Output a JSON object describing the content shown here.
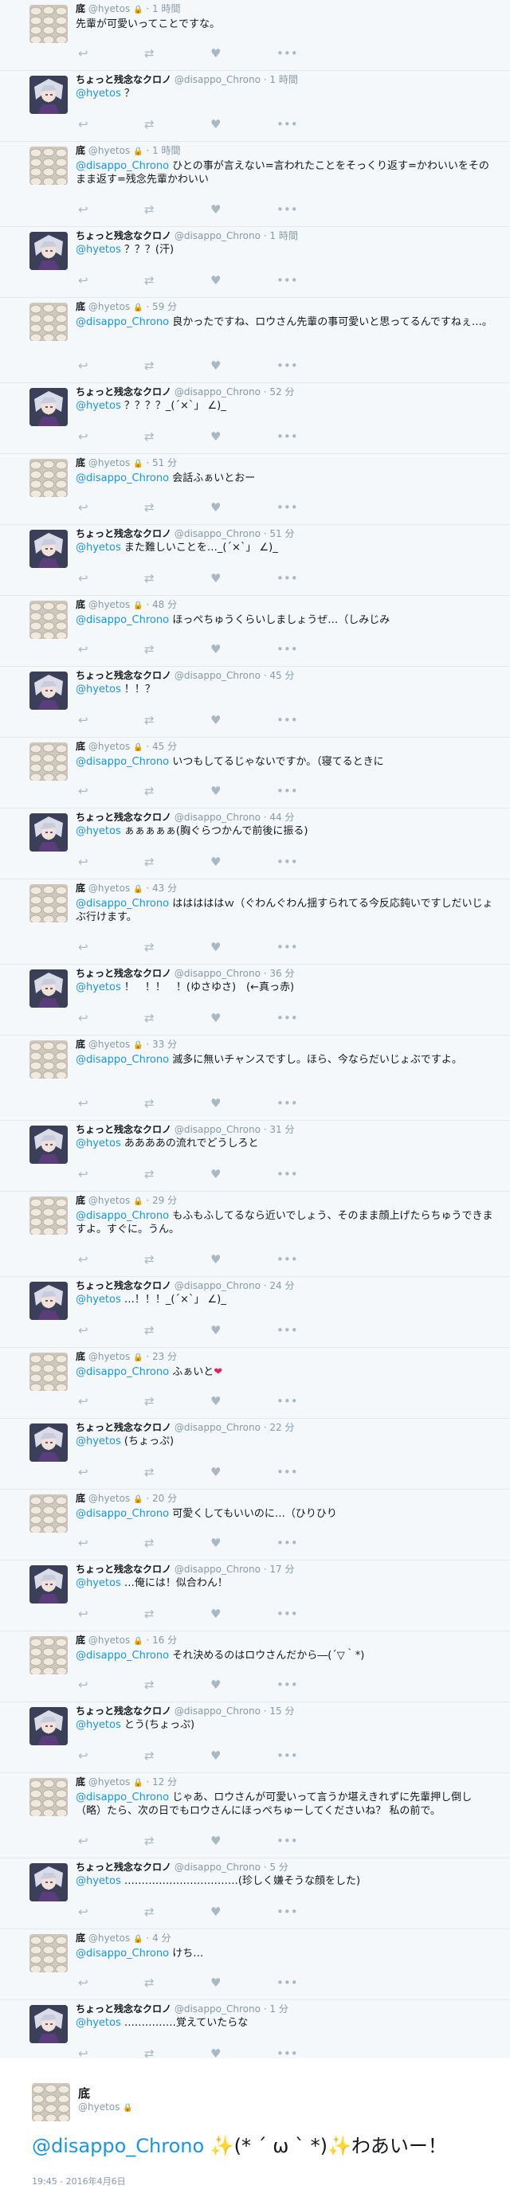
{
  "tweets": [
    {
      "author": "tofu",
      "name": "底",
      "handle": "@hyetos",
      "locked": true,
      "time": "1 時間",
      "mention": "",
      "text": "先輩が可愛いってことですな。",
      "tall": false
    },
    {
      "author": "chrono",
      "name": "ちょっと残念なクロノ",
      "handle": "@disappo_Chrono",
      "locked": false,
      "time": "1 時間",
      "mention": "@hyetos",
      "text": " ？",
      "tall": false
    },
    {
      "author": "tofu",
      "name": "底",
      "handle": "@hyetos",
      "locked": true,
      "time": "1 時間",
      "mention": "@disappo_Chrono",
      "text": " ひとの事が言えない=言われたことをそっくり返す=かわいいをそのまま返す=残念先輩かわいい",
      "tall": true
    },
    {
      "author": "chrono",
      "name": "ちょっと残念なクロノ",
      "handle": "@disappo_Chrono",
      "locked": false,
      "time": "1 時間",
      "mention": "@hyetos",
      "text": " ？？？(汗)",
      "tall": false
    },
    {
      "author": "tofu",
      "name": "底",
      "handle": "@hyetos",
      "locked": true,
      "time": "59 分",
      "mention": "@disappo_Chrono",
      "text": " 良かったですね、ロウさん先輩の事可愛いと思ってるんですねぇ…。",
      "tall": true
    },
    {
      "author": "chrono",
      "name": "ちょっと残念なクロノ",
      "handle": "@disappo_Chrono",
      "locked": false,
      "time": "52 分",
      "mention": "@hyetos",
      "text": " ？？？？_(´×`」 ∠)_",
      "tall": false
    },
    {
      "author": "tofu",
      "name": "底",
      "handle": "@hyetos",
      "locked": true,
      "time": "51 分",
      "mention": "@disappo_Chrono",
      "text": " 会話ふぁいとおー",
      "tall": false
    },
    {
      "author": "chrono",
      "name": "ちょっと残念なクロノ",
      "handle": "@disappo_Chrono",
      "locked": false,
      "time": "51 分",
      "mention": "@hyetos",
      "text": " また難しいことを…_(´×`」 ∠)_",
      "tall": false
    },
    {
      "author": "tofu",
      "name": "底",
      "handle": "@hyetos",
      "locked": true,
      "time": "48 分",
      "mention": "@disappo_Chrono",
      "text": " ほっぺちゅうくらいしましょうぜ…（しみじみ",
      "tall": false
    },
    {
      "author": "chrono",
      "name": "ちょっと残念なクロノ",
      "handle": "@disappo_Chrono",
      "locked": false,
      "time": "45 分",
      "mention": "@hyetos",
      "text": " ！！？",
      "tall": false
    },
    {
      "author": "tofu",
      "name": "底",
      "handle": "@hyetos",
      "locked": true,
      "time": "45 分",
      "mention": "@disappo_Chrono",
      "text": " いつもしてるじゃないですか。（寝てるときに",
      "tall": false
    },
    {
      "author": "chrono",
      "name": "ちょっと残念なクロノ",
      "handle": "@disappo_Chrono",
      "locked": false,
      "time": "44 分",
      "mention": "@hyetos",
      "text": " ぁぁぁぁぁ(胸ぐらつかんで前後に振る)",
      "tall": false
    },
    {
      "author": "tofu",
      "name": "底",
      "handle": "@hyetos",
      "locked": true,
      "time": "43 分",
      "mention": "@disappo_Chrono",
      "text": " はははははｗ（ぐわんぐわん揺すられてる今反応鈍いですしだいじょぶ行けます。",
      "tall": true
    },
    {
      "author": "chrono",
      "name": "ちょっと残念なクロノ",
      "handle": "@disappo_Chrono",
      "locked": false,
      "time": "36 分",
      "mention": "@hyetos",
      "text": " ！　！！　！(ゆさゆさ)　(←真っ赤)",
      "tall": false
    },
    {
      "author": "tofu",
      "name": "底",
      "handle": "@hyetos",
      "locked": true,
      "time": "33 分",
      "mention": "@disappo_Chrono",
      "text": " 滅多に無いチャンスですし。ほら、今ならだいじょぶですよ。",
      "tall": true
    },
    {
      "author": "chrono",
      "name": "ちょっと残念なクロノ",
      "handle": "@disappo_Chrono",
      "locked": false,
      "time": "31 分",
      "mention": "@hyetos",
      "text": " ああああの流れでどうしろと",
      "tall": false
    },
    {
      "author": "tofu",
      "name": "底",
      "handle": "@hyetos",
      "locked": true,
      "time": "29 分",
      "mention": "@disappo_Chrono",
      "text": " もふもふしてるなら近いでしょう、そのまま顔上げたらちゅうできますよ。すぐに。うん。",
      "tall": true
    },
    {
      "author": "chrono",
      "name": "ちょっと残念なクロノ",
      "handle": "@disappo_Chrono",
      "locked": false,
      "time": "24 分",
      "mention": "@hyetos",
      "text": " …！！！_(´×`」 ∠)_",
      "tall": false
    },
    {
      "author": "tofu",
      "name": "底",
      "handle": "@hyetos",
      "locked": true,
      "time": "23 分",
      "mention": "@disappo_Chrono",
      "text": " ふぁいと",
      "heart": "❤",
      "tall": false
    },
    {
      "author": "chrono",
      "name": "ちょっと残念なクロノ",
      "handle": "@disappo_Chrono",
      "locked": false,
      "time": "22 分",
      "mention": "@hyetos",
      "text": " (ちょっぷ)",
      "tall": false
    },
    {
      "author": "tofu",
      "name": "底",
      "handle": "@hyetos",
      "locked": true,
      "time": "20 分",
      "mention": "@disappo_Chrono",
      "text": " 可愛くしてもいいのに…（ひりひり",
      "tall": false
    },
    {
      "author": "chrono",
      "name": "ちょっと残念なクロノ",
      "handle": "@disappo_Chrono",
      "locked": false,
      "time": "17 分",
      "mention": "@hyetos",
      "text": " …俺には！似合わん！",
      "tall": false
    },
    {
      "author": "tofu",
      "name": "底",
      "handle": "@hyetos",
      "locked": true,
      "time": "16 分",
      "mention": "@disappo_Chrono",
      "text": " それ決めるのはロウさんだから―(´▽｀*)",
      "tall": false
    },
    {
      "author": "chrono",
      "name": "ちょっと残念なクロノ",
      "handle": "@disappo_Chrono",
      "locked": false,
      "time": "15 分",
      "mention": "@hyetos",
      "text": " とう(ちょっぷ)",
      "tall": false
    },
    {
      "author": "tofu",
      "name": "底",
      "handle": "@hyetos",
      "locked": true,
      "time": "12 分",
      "mention": "@disappo_Chrono",
      "text": " じゃあ、ロウさんが可愛いって言うか堪えきれずに先輩押し倒し（略）たら、次の日でもロウさんにほっぺちゅーしてくださいね？ 私の前で。",
      "tall": true
    },
    {
      "author": "chrono",
      "name": "ちょっと残念なクロノ",
      "handle": "@disappo_Chrono",
      "locked": false,
      "time": "5 分",
      "mention": "@hyetos",
      "text": " ……………………………(珍しく嫌そうな顔をした)",
      "tall": false
    },
    {
      "author": "tofu",
      "name": "底",
      "handle": "@hyetos",
      "locked": true,
      "time": "4 分",
      "mention": "@disappo_Chrono",
      "text": " けち…",
      "tall": false
    },
    {
      "author": "chrono",
      "name": "ちょっと残念なクロノ",
      "handle": "@disappo_Chrono",
      "locked": false,
      "time": "1 分",
      "mention": "@hyetos",
      "text": " ……………覚えていたらな",
      "tall": false
    }
  ],
  "icons": {
    "reply": "reply-icon",
    "retweet": "retweet-icon",
    "like": "heart-icon",
    "more": "more-icon",
    "lock": "lock-icon"
  },
  "main": {
    "name": "底",
    "handle": "@hyetos",
    "mention": "@disappo_Chrono",
    "text_a": " ✨",
    "text_b": "(* ´ ω ` *)",
    "text_c": "✨",
    "text_d": "わあいー！",
    "time": "19:45 - 2016年4月6日"
  },
  "colors": {
    "mention": "#1b95e0",
    "meta": "#8899a6",
    "heart": "#e0245e",
    "bg": "#f5f8fa"
  }
}
